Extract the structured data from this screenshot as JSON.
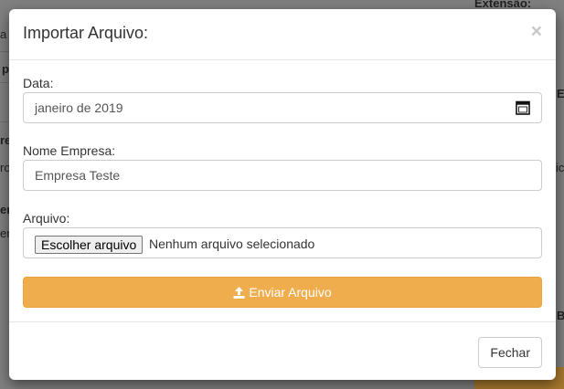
{
  "background": {
    "fragments": [
      "Extensão:",
      "a T",
      "p",
      "Ex",
      "re",
      "ro",
      "ic",
      "er",
      "en",
      "B"
    ]
  },
  "modal": {
    "title": "Importar Arquivo:",
    "close_symbol": "×",
    "date_field": {
      "label": "Data:",
      "value": "janeiro de 2019",
      "icon": "calendar-icon"
    },
    "company_field": {
      "label": "Nome Empresa:",
      "value": "Empresa Teste"
    },
    "file_field": {
      "label": "Arquivo:",
      "button_label": "Escolher arquivo",
      "status": "Nenhum arquivo selecionado"
    },
    "submit": {
      "label": "Enviar Arquivo",
      "icon": "upload-icon"
    },
    "footer": {
      "close_label": "Fechar"
    }
  },
  "colors": {
    "accent": "#f0ad4e",
    "overlay": "#808080"
  }
}
